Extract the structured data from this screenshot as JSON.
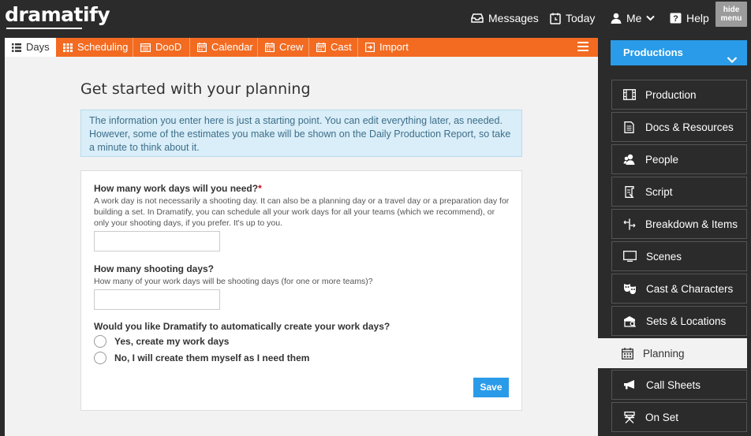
{
  "app": {
    "logo": "dramatify"
  },
  "topnav": {
    "messages": "Messages",
    "today": "Today",
    "me": "Me",
    "help": "Help",
    "hide_line1": "hide",
    "hide_line2": "menu"
  },
  "tabs": [
    {
      "label": "Days",
      "icon": "list-icon",
      "active": true
    },
    {
      "label": "Scheduling",
      "icon": "grid-icon"
    },
    {
      "label": "DooD",
      "icon": "table-icon"
    },
    {
      "label": "Calendar",
      "icon": "calendar-icon"
    },
    {
      "label": "Crew",
      "icon": "calendar-icon"
    },
    {
      "label": "Cast",
      "icon": "calendar-icon"
    },
    {
      "label": "Import",
      "icon": "import-icon"
    }
  ],
  "page": {
    "title": "Get started with your planning",
    "info": "The information you enter here is just a starting point. You can edit everything later, as needed. However, some of the estimates you make will be shown on the Daily Production Report, so take a minute to think about it."
  },
  "form": {
    "q1": "How many work days will you need?",
    "q1_required": "*",
    "q1_hint": "A work day is not necessarily a shooting day. It can also be a planning day or a travel day or a preparation day for building a set. In Dramatify, you can schedule all your work days for all your teams (which we recommend), or only your shooting days, if you prefer. It's up to you.",
    "q1_value": "",
    "q2": "How many shooting days?",
    "q2_hint": "How many of your work days will be shooting days (for one or more teams)?",
    "q2_value": "",
    "q3": "Would you like Dramatify to automatically create your work days?",
    "opt_yes": "Yes, create my work days",
    "opt_no": "No, I will create them myself as I need them",
    "save": "Save"
  },
  "sidebar": {
    "productions": "Productions",
    "items": [
      {
        "label": "Production",
        "icon": "film-icon"
      },
      {
        "label": "Docs & Resources",
        "icon": "document-icon"
      },
      {
        "label": "People",
        "icon": "people-icon"
      },
      {
        "label": "Script",
        "icon": "script-icon"
      },
      {
        "label": "Breakdown & Items",
        "icon": "breakdown-icon"
      },
      {
        "label": "Scenes",
        "icon": "monitor-icon"
      },
      {
        "label": "Cast & Characters",
        "icon": "masks-icon"
      },
      {
        "label": "Sets & Locations",
        "icon": "location-icon"
      },
      {
        "label": "Planning",
        "icon": "calendar-icon",
        "active": true
      },
      {
        "label": "Call Sheets",
        "icon": "megaphone-icon"
      },
      {
        "label": "On Set",
        "icon": "directors-chair-icon"
      }
    ]
  },
  "colors": {
    "accent_orange": "#f26b21",
    "accent_blue": "#2a9be8",
    "dark": "#2b2b2b"
  }
}
